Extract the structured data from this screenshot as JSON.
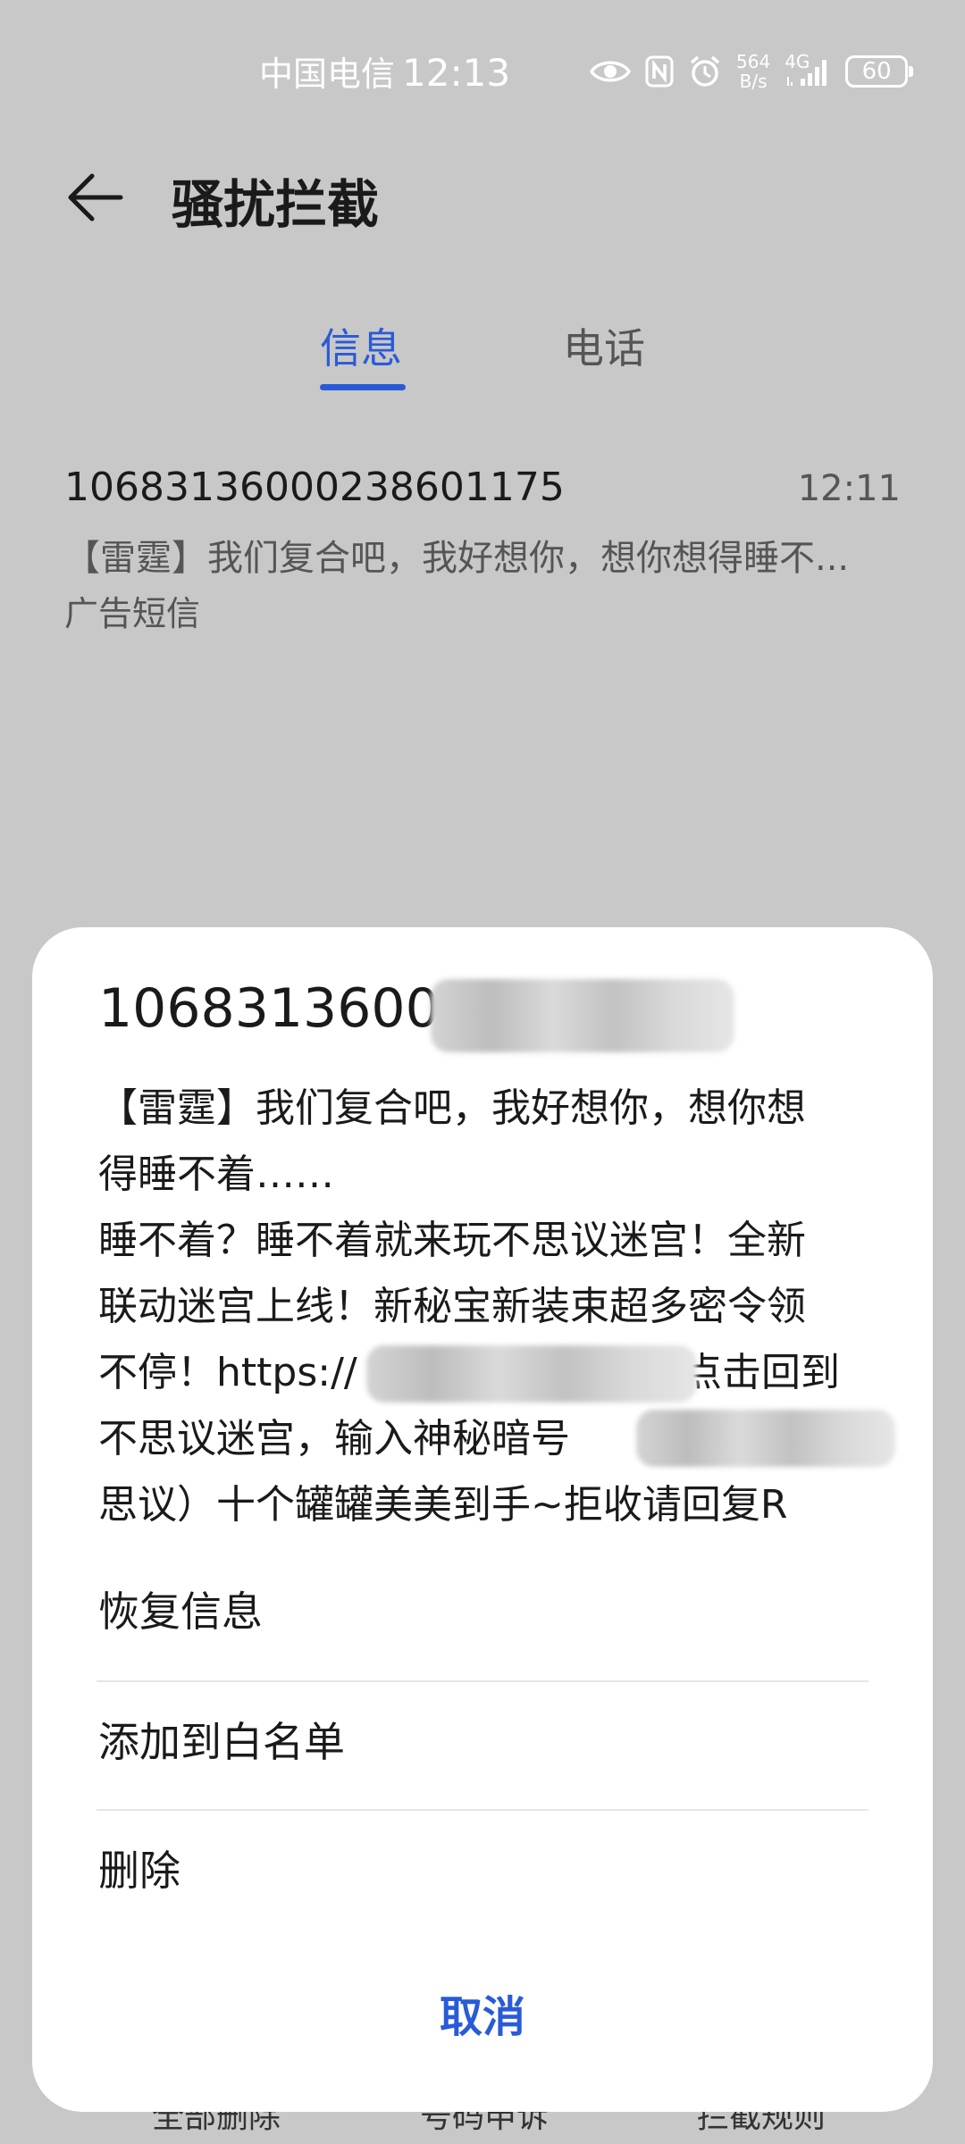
{
  "status_bar": {
    "carrier": "中国电信",
    "time": "12:13",
    "net_speed_value": "564",
    "net_speed_unit": "B/s",
    "network_type": "4G",
    "battery": "60"
  },
  "header": {
    "title": "骚扰拦截"
  },
  "tabs": [
    {
      "label": "信息",
      "active": true
    },
    {
      "label": "电话",
      "active": false
    }
  ],
  "message_list": [
    {
      "number": "10683136000238601175",
      "time": "12:11",
      "preview": "【雷霆】我们复合吧，我好想你，想你想得睡不...",
      "tag": "广告短信"
    }
  ],
  "bottom_toolbar": {
    "items": [
      "全部删除",
      "号码申诉",
      "拦截规则"
    ]
  },
  "sheet": {
    "number_visible": "10683136000",
    "body_lines": [
      "【雷霆】我们复合吧，我好想你，想你想",
      "得睡不着……",
      "睡不着？睡不着就来玩不思议迷宫！全新",
      "联动迷宫上线！新秘宝新装束超多密令领",
      "不停！https://",
      "点击回到",
      "不思议迷宫，输入神秘暗号",
      "思议）十个罐罐美美到手~拒收请回复R"
    ],
    "actions": [
      "恢复信息",
      "添加到白名单",
      "删除"
    ],
    "cancel_label": "取消"
  },
  "colors": {
    "accent": "#2a5bd7",
    "scrim_background": "#c8c8c8",
    "sheet_background": "#ffffff"
  }
}
